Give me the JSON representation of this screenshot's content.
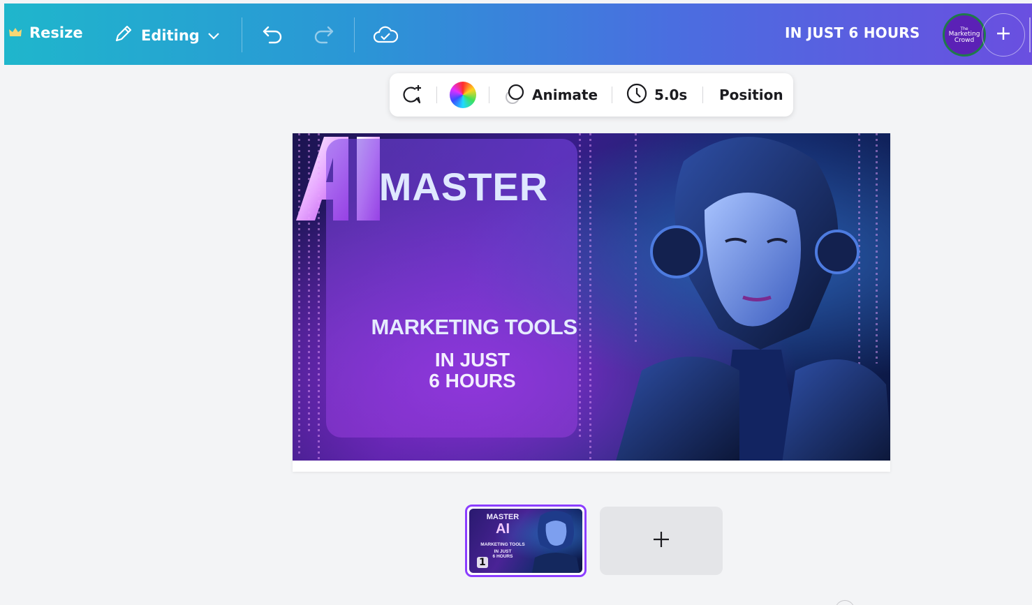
{
  "header": {
    "resize_label": "Resize",
    "editing_label": "Editing",
    "design_title": "IN JUST 6 HOURS",
    "avatar": {
      "line1": "The",
      "line2": "Marketing",
      "line3": "Crowd"
    }
  },
  "context_toolbar": {
    "animate_label": "Animate",
    "duration_label": "5.0s",
    "position_label": "Position"
  },
  "design": {
    "headline": "MASTER",
    "logo_text": "AI",
    "subhead": "MARKETING TOOLS",
    "tagline_line1": "IN JUST",
    "tagline_line2": "6 HOURS"
  },
  "pages": {
    "thumbnails": [
      {
        "number": "1",
        "headline": "MASTER",
        "logo_text": "AI",
        "subhead": "MARKETING TOOLS",
        "tagline_line1": "IN JUST",
        "tagline_line2": "6 HOURS"
      }
    ]
  },
  "colors": {
    "header_gradient_start": "#1fb6cc",
    "header_gradient_end": "#6a4fe0",
    "selection": "#8b3dff"
  },
  "icons": [
    "crown-icon",
    "pencil-icon",
    "chevron-down-icon",
    "undo-icon",
    "redo-icon",
    "cloud-saved-icon",
    "plus-icon",
    "comment-add-icon",
    "color-wheel-icon",
    "animate-icon",
    "clock-icon"
  ]
}
